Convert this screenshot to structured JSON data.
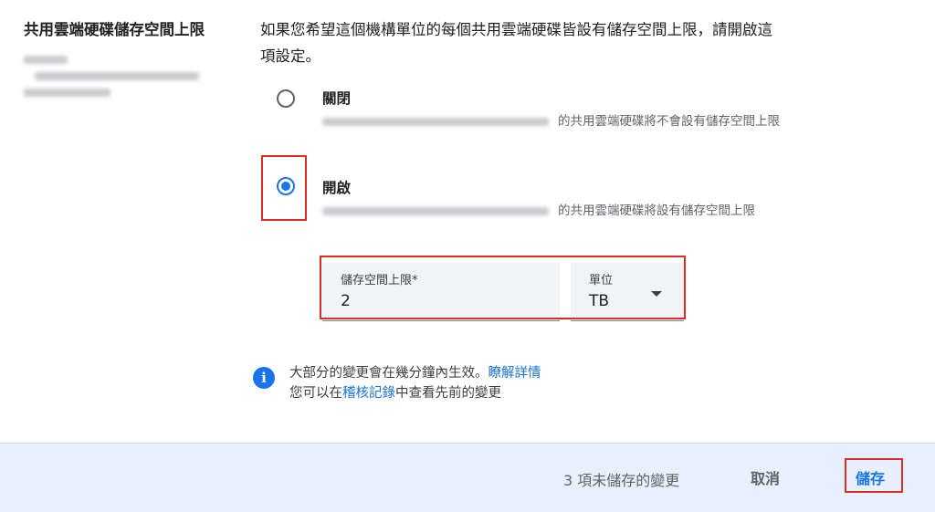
{
  "setting": {
    "title": "共用雲端硬碟儲存空間上限"
  },
  "description": "如果您希望這個機構單位的每個共用雲端硬碟皆設有儲存空間上限，請開啟這項設定。",
  "options": {
    "off": {
      "label": "關閉",
      "description": "的共用雲端硬碟將不會設有儲存空間上限",
      "selected": false
    },
    "on": {
      "label": "開啟",
      "description": "的共用雲端硬碟將設有儲存空間上限",
      "selected": true
    }
  },
  "storage_limit": {
    "label": "儲存空間上限*",
    "value": "2"
  },
  "unit": {
    "label": "單位",
    "value": "TB"
  },
  "info": {
    "line1": "大部分的變更會在幾分鐘內生效。",
    "line1_link": "瞭解詳情",
    "line2_prefix": "您可以在",
    "line2_link": "稽核記錄",
    "line2_suffix": "中查看先前的變更"
  },
  "footer": {
    "unsaved": "3 項未儲存的變更",
    "cancel": "取消",
    "save": "儲存"
  },
  "colors": {
    "accent": "#1a73e8",
    "highlight_border": "#d93025",
    "footer_bg": "#e8f0fe"
  }
}
